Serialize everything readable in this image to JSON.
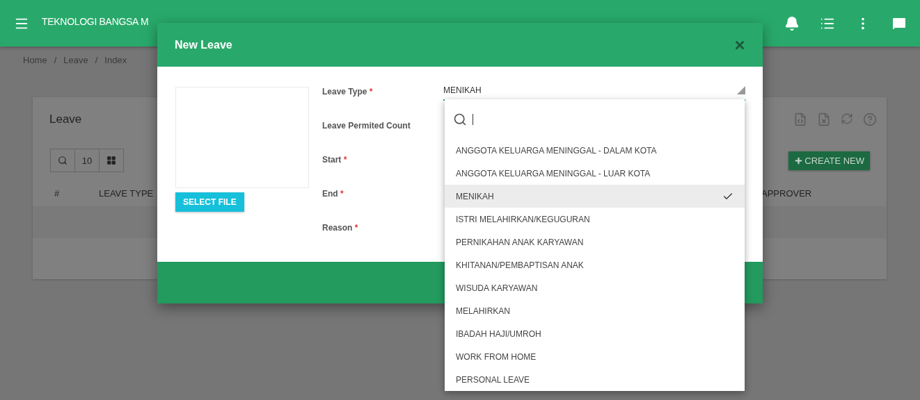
{
  "topbar": {
    "title": "TEKNOLOGI BANGSA M"
  },
  "breadcrumb": {
    "separator": "/",
    "items": [
      "Home",
      "Leave",
      "Index"
    ]
  },
  "card": {
    "title": "Leave",
    "page_size": "10",
    "create_button": "CREATE NEW",
    "columns": [
      "#",
      "LEAVE TYPE",
      "APPROVER"
    ]
  },
  "modal": {
    "title": "New Leave",
    "select_file_button": "SELECT FILE",
    "required_mark": "*",
    "fields": [
      {
        "label": "Leave Type",
        "required": true
      },
      {
        "label": "Leave Permited Count",
        "required": false
      },
      {
        "label": "Start",
        "required": true
      },
      {
        "label": "End",
        "required": true
      },
      {
        "label": "Reason",
        "required": true
      }
    ],
    "leave_type": {
      "value": "MENIKAH",
      "expanded": true
    },
    "dropdown": {
      "options": [
        {
          "label": "ANGGOTA KELUARGA MENINGGAL - DALAM KOTA",
          "selected": false
        },
        {
          "label": "ANGGOTA KELUARGA MENINGGAL - LUAR KOTA",
          "selected": false
        },
        {
          "label": "MENIKAH",
          "selected": true
        },
        {
          "label": "ISTRI MELAHIRKAN/KEGUGURAN",
          "selected": false
        },
        {
          "label": "PERNIKAHAN ANAK KARYAWAN",
          "selected": false
        },
        {
          "label": "KHITANAN/PEMBAPTISAN ANAK",
          "selected": false
        },
        {
          "label": "WISUDA KARYAWAN",
          "selected": false
        },
        {
          "label": "MELAHIRKAN",
          "selected": false
        },
        {
          "label": "IBADAH HAJI/UMROH",
          "selected": false
        },
        {
          "label": "WORK FROM HOME",
          "selected": false
        },
        {
          "label": "PERSONAL LEAVE",
          "selected": false
        }
      ]
    }
  }
}
